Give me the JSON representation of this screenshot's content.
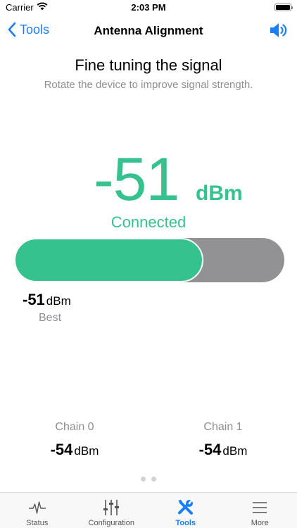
{
  "status_bar": {
    "carrier": "Carrier",
    "time": "2:03 PM"
  },
  "nav": {
    "back_label": "Tools",
    "title": "Antenna Alignment"
  },
  "header": {
    "title": "Fine tuning the signal",
    "subtitle": "Rotate the device to improve signal strength."
  },
  "signal": {
    "value": "-51",
    "unit": "dBm",
    "state": "Connected",
    "level_fraction": 0.7
  },
  "best": {
    "value": "-51",
    "unit": "dBm",
    "label": "Best"
  },
  "chains": [
    {
      "label": "Chain 0",
      "value": "-54",
      "unit": "dBm"
    },
    {
      "label": "Chain 1",
      "value": "-54",
      "unit": "dBm"
    }
  ],
  "tabs": [
    {
      "label": "Status",
      "icon": "pulse-icon"
    },
    {
      "label": "Configuration",
      "icon": "sliders-icon"
    },
    {
      "label": "Tools",
      "icon": "tools-icon"
    },
    {
      "label": "More",
      "icon": "menu-icon"
    }
  ],
  "colors": {
    "accent": "#35c28e",
    "link": "#1a7ef5",
    "track": "#929295"
  }
}
